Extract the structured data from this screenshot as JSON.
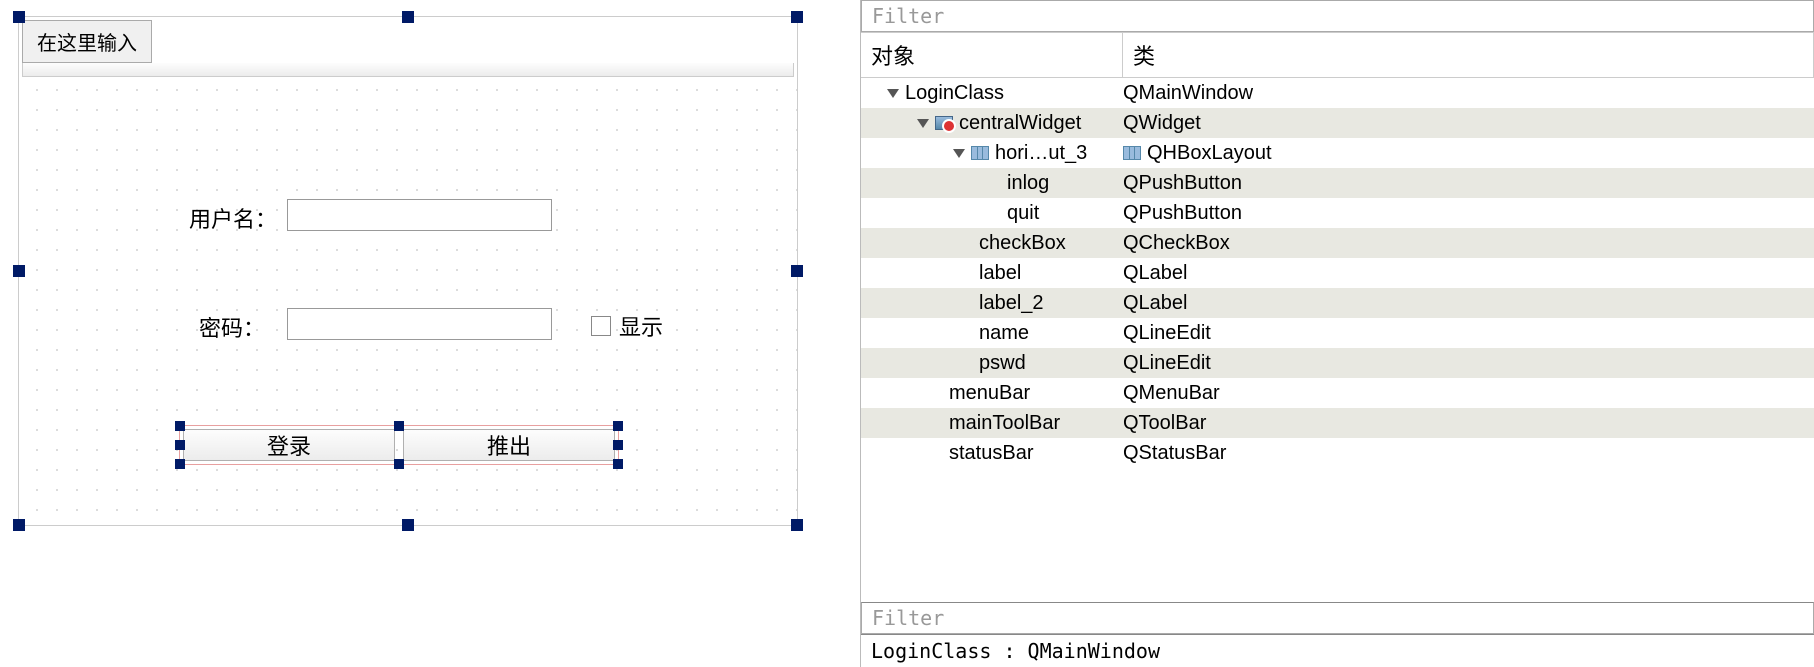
{
  "designer": {
    "tab_label": "在这里输入",
    "username_label": "用户名：",
    "password_label": "密码：",
    "show_label": "显示",
    "login_button": "登录",
    "quit_button": "推出"
  },
  "inspector": {
    "filter_placeholder_top": "Filter",
    "filter_placeholder_bottom": "Filter",
    "headers": {
      "object": "对象",
      "class": "类"
    },
    "rows": [
      {
        "obj": "LoginClass",
        "cls": "QMainWindow",
        "indent": 20,
        "expander": true,
        "alt": false
      },
      {
        "obj": "centralWidget",
        "cls": "QWidget",
        "indent": 50,
        "expander": true,
        "icon": "widget-forbid",
        "alt": true
      },
      {
        "obj": "hori…ut_3",
        "cls": "QHBoxLayout",
        "indent": 86,
        "expander": true,
        "icon": "layout",
        "clsIcon": "layout",
        "alt": false
      },
      {
        "obj": "inlog",
        "cls": "QPushButton",
        "indent": 140,
        "alt": true
      },
      {
        "obj": "quit",
        "cls": "QPushButton",
        "indent": 140,
        "alt": false
      },
      {
        "obj": "checkBox",
        "cls": "QCheckBox",
        "indent": 112,
        "alt": true
      },
      {
        "obj": "label",
        "cls": "QLabel",
        "indent": 112,
        "alt": false
      },
      {
        "obj": "label_2",
        "cls": "QLabel",
        "indent": 112,
        "alt": true
      },
      {
        "obj": "name",
        "cls": "QLineEdit",
        "indent": 112,
        "alt": false
      },
      {
        "obj": "pswd",
        "cls": "QLineEdit",
        "indent": 112,
        "alt": true
      },
      {
        "obj": "menuBar",
        "cls": "QMenuBar",
        "indent": 82,
        "alt": false
      },
      {
        "obj": "mainToolBar",
        "cls": "QToolBar",
        "indent": 82,
        "alt": true
      },
      {
        "obj": "statusBar",
        "cls": "QStatusBar",
        "indent": 82,
        "alt": false
      }
    ],
    "status": "LoginClass : QMainWindow"
  }
}
